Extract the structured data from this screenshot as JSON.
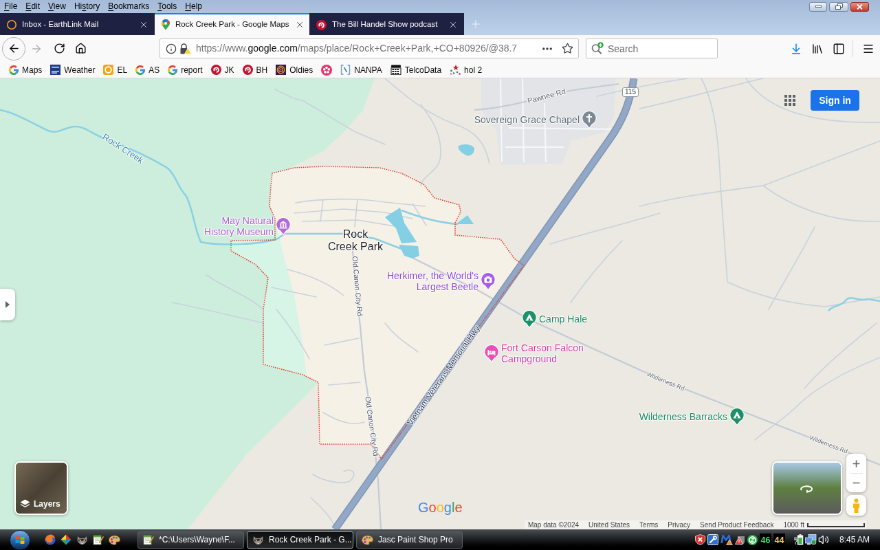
{
  "menu_bar": [
    {
      "key": "F",
      "after": "ile"
    },
    {
      "key": "E",
      "after": "dit"
    },
    {
      "key": "V",
      "after": "iew"
    },
    {
      "before": "Hi",
      "key": "s",
      "after": "tory"
    },
    {
      "key": "B",
      "after": "ookmarks"
    },
    {
      "key": "T",
      "after": "ools"
    },
    {
      "key": "H",
      "after": "elp"
    }
  ],
  "tabs": [
    {
      "title": "Inbox - EarthLink Mail",
      "selected": false
    },
    {
      "title": "Rock Creek Park - Google Maps",
      "selected": true
    },
    {
      "title": "The Bill Handel Show podcast",
      "selected": false
    }
  ],
  "toolbar": {
    "back_disabled": false,
    "forward_disabled": true,
    "url_prefix": "https://www.",
    "url_domain": "google.com",
    "url_path": "/maps/place/Rock+Creek+Park,+CO+80926/@38.7",
    "search_placeholder": "Search"
  },
  "bookmarks": [
    {
      "kind": "labeled",
      "label": "Maps"
    },
    {
      "kind": "labeled",
      "label": "Weather"
    },
    {
      "kind": "labeled",
      "label": "EL"
    },
    {
      "kind": "labeled",
      "label": "AS"
    },
    {
      "kind": "labeled",
      "label": "report"
    },
    {
      "kind": "labeled",
      "label": "JK"
    },
    {
      "kind": "labeled",
      "label": "BH"
    },
    {
      "kind": "labeled",
      "label": "Oldies"
    },
    {
      "kind": "icon_only"
    },
    {
      "kind": "labeled",
      "label": "NANPA"
    },
    {
      "kind": "labeled",
      "label": "TelcoData"
    },
    {
      "kind": "labeled",
      "label": "hol 2"
    }
  ],
  "map": {
    "route_shield": "115",
    "water_label": "Rock Creek",
    "area_label": "Rock Creek Park",
    "road_labels": [
      "Pawnee Rd",
      "Old Canon City Rd",
      "Old Canon City Rd",
      "Vietnam Veterans Memorial Hwy",
      "Wilderness Rd",
      "Wilderness Rd"
    ],
    "places": [
      {
        "kind": "worship",
        "name": "Sovereign Grace Chapel"
      },
      {
        "kind": "museum",
        "name": "May Natural History Museum"
      },
      {
        "kind": "attraction",
        "name": "Herkimer, the World's Largest Beetle"
      },
      {
        "kind": "campground",
        "name": "Camp Hale"
      },
      {
        "kind": "lodging",
        "name": "Fort Carson Falcon Campground"
      },
      {
        "kind": "campground",
        "name": "Wilderness Barracks"
      }
    ],
    "sign_in": "Sign in",
    "layers": "Layers",
    "logo": "Google",
    "footer": [
      "Map data ©2024",
      "United States",
      "Terms",
      "Privacy",
      "Send Product Feedback"
    ],
    "scale": "1000 ft"
  },
  "taskbar": {
    "windows": [
      {
        "title": "*C:\\Users\\Wayne\\F...",
        "selected": false
      },
      {
        "title": "Rock Creek Park - G...",
        "selected": true
      },
      {
        "title": "Jasc Paint Shop Pro",
        "selected": false
      }
    ],
    "counters": [
      {
        "value": "46",
        "color": "#3ddc6a"
      },
      {
        "value": "44",
        "color": "#f2c94c"
      }
    ],
    "clock": "8:45 AM"
  }
}
